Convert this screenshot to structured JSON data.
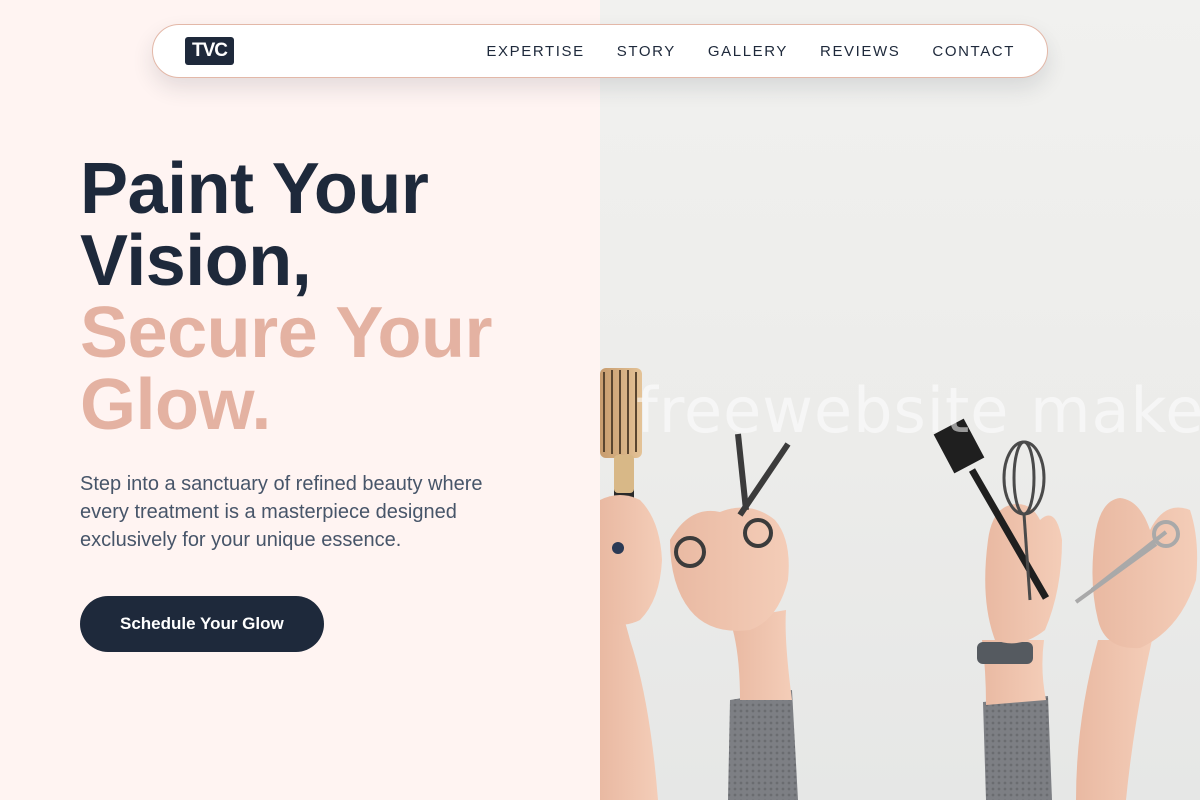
{
  "nav": {
    "logo": "TVC",
    "links": [
      "EXPERTISE",
      "STORY",
      "GALLERY",
      "REVIEWS",
      "CONTACT"
    ]
  },
  "hero": {
    "headline_dark_1": "Paint Your",
    "headline_dark_2": "Vision,",
    "headline_accent_1": "Secure Your",
    "headline_accent_2": "Glow.",
    "subtext": "Step into a sanctuary of refined beauty where every treatment is a masterpiece designed exclusively for your unique essence.",
    "cta_label": "Schedule Your Glow"
  },
  "image": {
    "watermark": "freewebsite makeup"
  },
  "colors": {
    "navy": "#1e293b",
    "accent": "#e4b2a2",
    "background": "#fff4f2"
  }
}
